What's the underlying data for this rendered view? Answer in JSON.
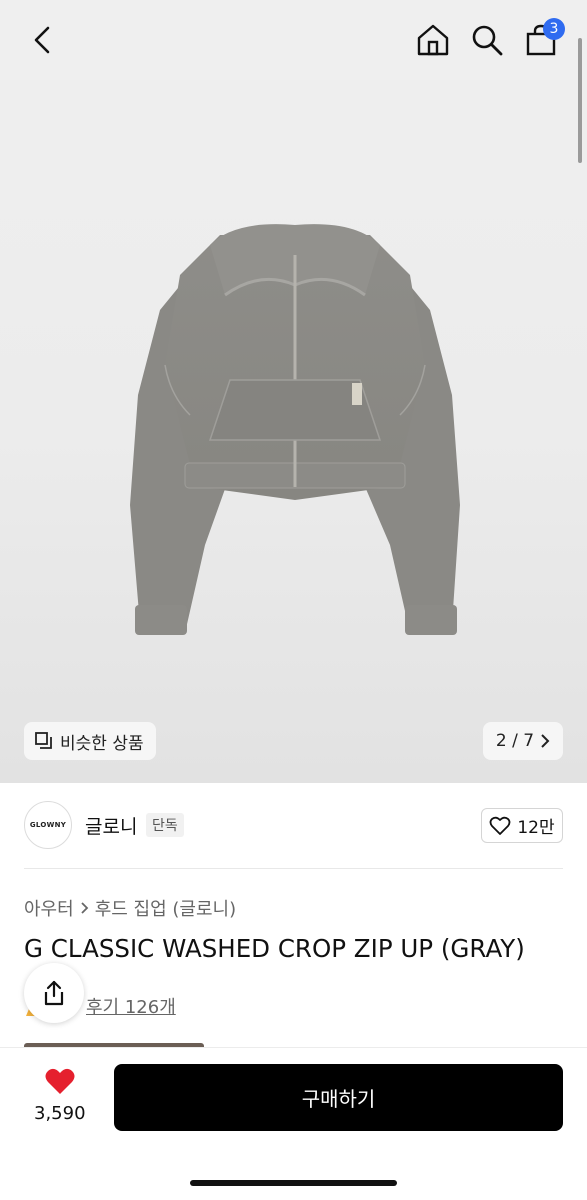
{
  "header": {
    "cart_count": "3",
    "icons": [
      "back-chevron-icon",
      "home-icon",
      "search-icon",
      "shopping-bag-icon"
    ]
  },
  "gallery": {
    "similar_label": "비슷한 상품",
    "counter": "2 / 7",
    "image_alt": "gray cropped zip-up hoodie"
  },
  "brand": {
    "logo_text": "GLOWNY",
    "name": "글로니",
    "tag": "단독",
    "likes": "12만"
  },
  "product": {
    "breadcrumb": [
      "아우터",
      "후드 집업 (글로니)"
    ],
    "title": "G CLASSIC WASHED CROP ZIP UP (GRAY)",
    "review_text": "후기 126개"
  },
  "bottom_bar": {
    "favorite_count": "3,590",
    "buy_label": "구매하기",
    "heart_color": "#e5202e"
  },
  "colors": {
    "accent_badge": "#2f6bf0",
    "buy_button": "#000000"
  }
}
